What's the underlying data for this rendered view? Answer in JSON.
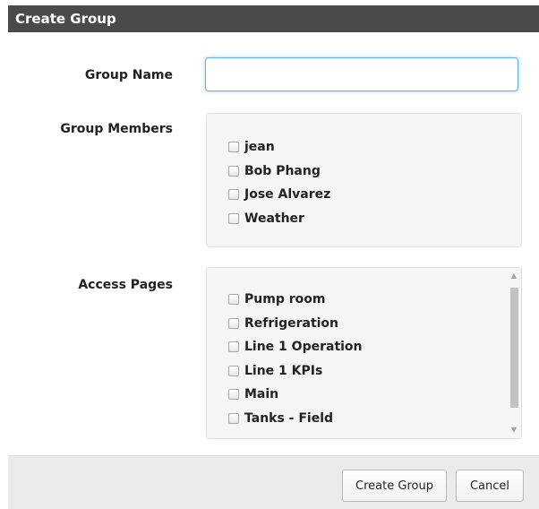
{
  "dialog": {
    "title": "Create Group",
    "group_name": {
      "label": "Group Name",
      "value": "",
      "placeholder": ""
    },
    "group_members": {
      "label": "Group Members",
      "items": [
        {
          "label": "jean",
          "checked": false
        },
        {
          "label": "Bob Phang",
          "checked": false
        },
        {
          "label": "Jose Alvarez",
          "checked": false
        },
        {
          "label": "Weather",
          "checked": false
        }
      ]
    },
    "access_pages": {
      "label": "Access Pages",
      "items": [
        {
          "label": "Pump room",
          "checked": false
        },
        {
          "label": "Refrigeration",
          "checked": false
        },
        {
          "label": "Line 1 Operation",
          "checked": false
        },
        {
          "label": "Line 1 KPIs",
          "checked": false
        },
        {
          "label": "Main",
          "checked": false
        },
        {
          "label": "Tanks - Field",
          "checked": false
        }
      ]
    },
    "buttons": {
      "create": "Create Group",
      "cancel": "Cancel"
    }
  },
  "colors": {
    "titlebar": "#4a4a4a",
    "input_focus_border": "#66afe9",
    "panel_background": "#f5f5f5",
    "footer_background": "#ebebeb"
  },
  "icons": {
    "scroll_up": "scroll-up-arrow-icon",
    "scroll_down": "scroll-down-arrow-icon"
  }
}
